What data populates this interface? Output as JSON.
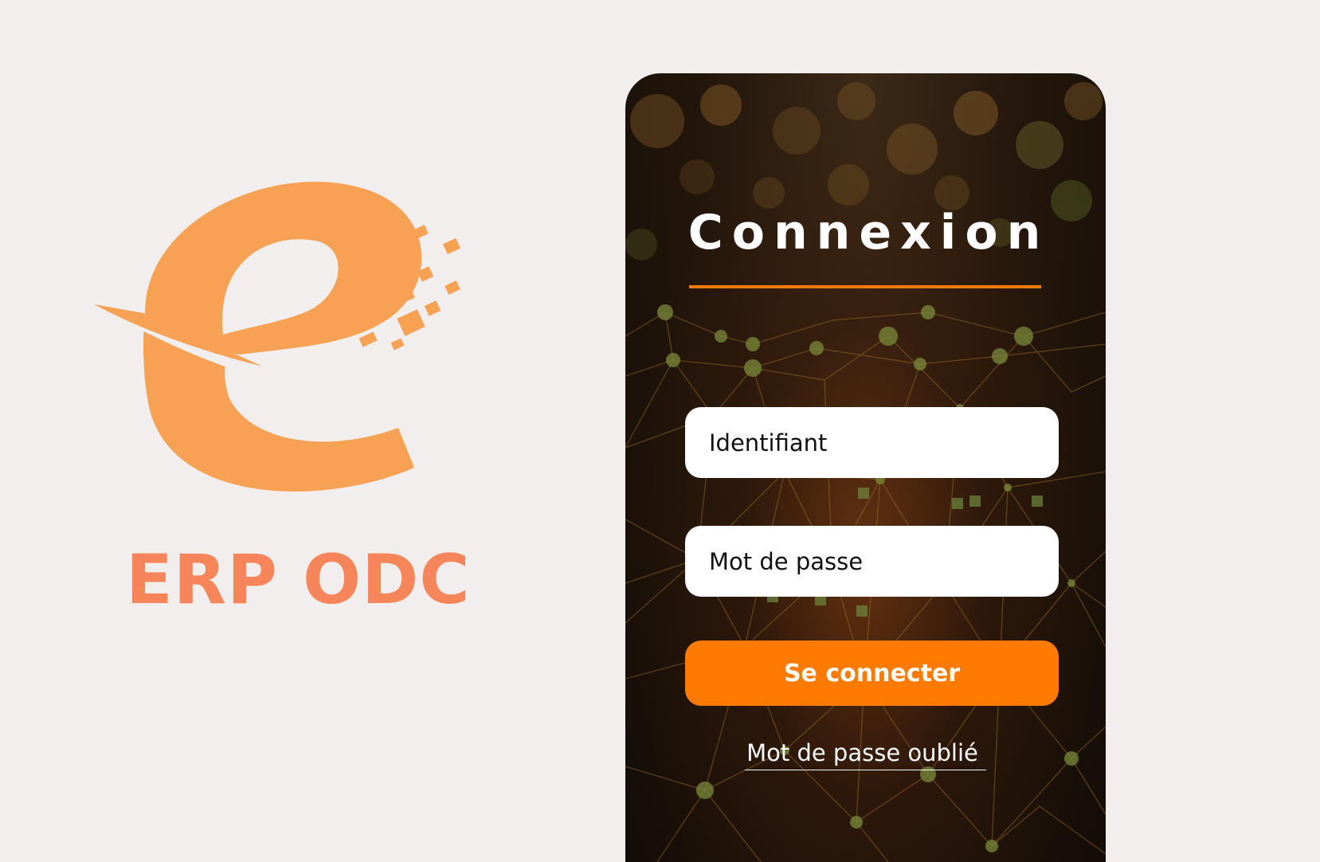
{
  "brand": {
    "logo_text": "ERP ODC",
    "logo_icon": "stylized-e-pixel-icon",
    "logo_color": "#f6a153",
    "logo_text_color": "#f6865a"
  },
  "login": {
    "title": "Connexion",
    "username_placeholder": "Identifiant",
    "password_placeholder": "Mot de passe",
    "submit_label": "Se connecter",
    "forgot_label": "Mot de passe oublié",
    "accent_color": "#ff7a00",
    "background": "dark-network-pattern"
  }
}
